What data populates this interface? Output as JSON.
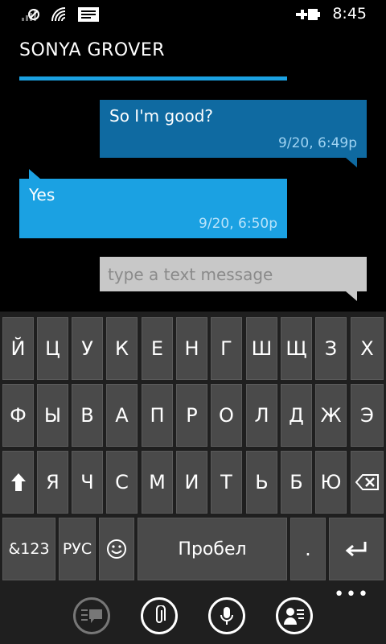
{
  "status": {
    "time": "8:45",
    "icons": [
      "signal-off-icon",
      "wifi-icon",
      "message-icon",
      "charging-battery-icon"
    ]
  },
  "conversation": {
    "contact_name": "SONYA GROVER",
    "messages": [
      {
        "direction": "out",
        "text": "So I'm good?",
        "timestamp": "9/20, 6:49p"
      },
      {
        "direction": "in",
        "text": "Yes",
        "timestamp": "9/20, 6:50p"
      }
    ]
  },
  "composer": {
    "placeholder": "type a text message",
    "value": ""
  },
  "keyboard": {
    "row1": [
      "Й",
      "Ц",
      "У",
      "К",
      "Е",
      "Н",
      "Г",
      "Ш",
      "Щ",
      "З",
      "Х"
    ],
    "row2": [
      "Ф",
      "Ы",
      "В",
      "А",
      "П",
      "Р",
      "О",
      "Л",
      "Д",
      "Ж",
      "Э"
    ],
    "row3_letters": [
      "Я",
      "Ч",
      "С",
      "М",
      "И",
      "Т",
      "Ь",
      "Б",
      "Ю"
    ],
    "shift_icon": "shift-up-arrow-icon",
    "backspace_icon": "backspace-icon",
    "symbols": "&123",
    "language": "РУС",
    "emoji_icon": "smiley-icon",
    "space": "Пробел",
    "period": ".",
    "enter_icon": "enter-icon"
  },
  "appbar": {
    "buttons": [
      "switch-sim-icon",
      "attach-icon",
      "voice-icon",
      "contact-card-icon"
    ],
    "more": "•••"
  },
  "colors": {
    "accent": "#1ba1e2",
    "outgoing_bubble": "#0f6aa1",
    "key": "#4a4a4a",
    "composer": "#c8c8c8"
  }
}
